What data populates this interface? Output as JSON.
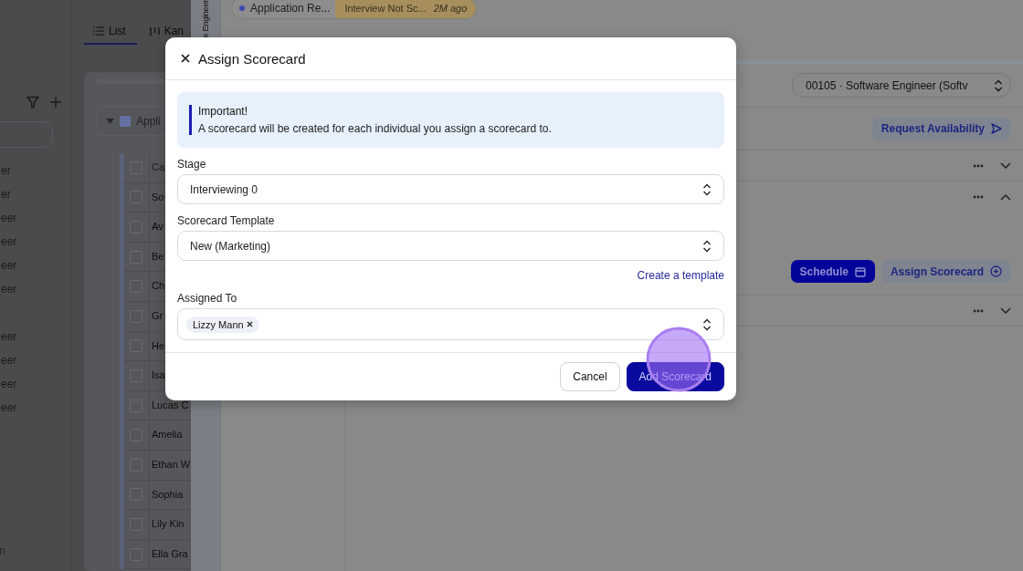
{
  "sidebar": {
    "groups": [
      {
        "items": [
          "er",
          "er",
          "eer",
          "eer",
          "eer",
          "eer"
        ]
      },
      {
        "items": [
          "eer",
          "eer",
          "eer",
          "eer"
        ]
      }
    ],
    "footer": "n"
  },
  "list_panel": {
    "tabs": [
      {
        "label": "List",
        "selected": true
      },
      {
        "label": "Kan",
        "selected": false
      }
    ],
    "group": {
      "label": "Appli",
      "expanded": true
    },
    "header": "Ca",
    "header_checked": false,
    "rows": [
      {
        "name": "So",
        "checked": false
      },
      {
        "name": "Av",
        "checked": false
      },
      {
        "name": "Be",
        "checked": false
      },
      {
        "name": "Ch",
        "checked": false
      },
      {
        "name": "Gr",
        "checked": false
      },
      {
        "name": "He",
        "checked": false
      },
      {
        "name": "Isa",
        "checked": false
      },
      {
        "name": "Lucas C",
        "checked": false
      },
      {
        "name": "Amelia",
        "checked": false
      },
      {
        "name": "Ethan W",
        "checked": false
      },
      {
        "name": "Sophia",
        "checked": false
      },
      {
        "name": "Lily Kin",
        "checked": false
      },
      {
        "name": "Ella Gra",
        "checked": false
      }
    ]
  },
  "drawer": {
    "side_tab": "e Engineer",
    "status": {
      "stage": "Application Re...",
      "tag": "Interview Not Sc...",
      "time": "2M ago"
    },
    "job_select": {
      "value": "00105 · Software Engineer (Softv"
    },
    "request_button": "Request Availability",
    "sections": [
      {
        "expanded": false
      },
      {
        "expanded": true,
        "actions": [
          {
            "label": "Schedule",
            "kind": "primary"
          },
          {
            "label": "Assign Scorecard",
            "kind": "secondary"
          }
        ]
      },
      {
        "expanded": false
      }
    ]
  },
  "modal": {
    "title": "Assign Scorecard",
    "notice": {
      "title": "Important!",
      "text": "A scorecard will be created for each individual you assign a scorecard to."
    },
    "fields": [
      {
        "kind": "select",
        "label": "Stage",
        "value": "Interviewing 0"
      },
      {
        "kind": "select",
        "label": "Scorecard Template",
        "value": "New (Marketing)",
        "link": "Create a template"
      },
      {
        "kind": "tags",
        "label": "Assigned To",
        "tags": [
          "Lizzy Mann"
        ]
      }
    ],
    "buttons": [
      {
        "label": "Cancel",
        "kind": "secondary"
      },
      {
        "label": "Add Scorecard",
        "kind": "primary"
      }
    ]
  }
}
